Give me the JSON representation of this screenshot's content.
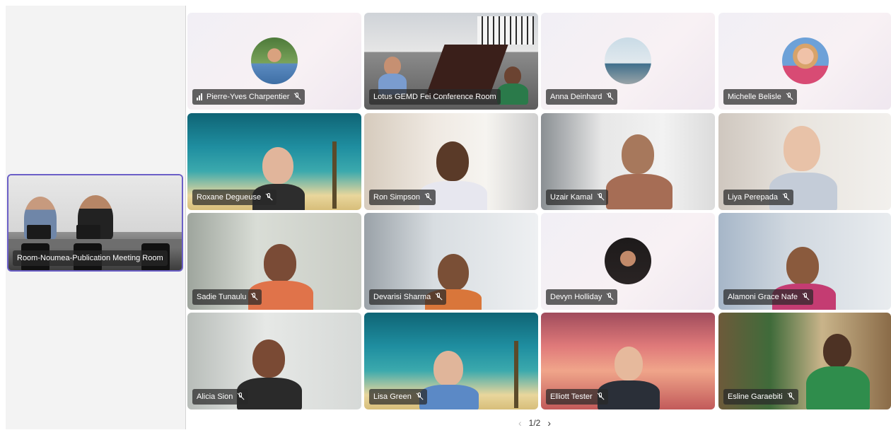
{
  "spotlight": {
    "name": "Room-Noumea-Publication Meeting Room"
  },
  "participants": [
    {
      "name": "Pierre-Yves Charpentier",
      "signal": true
    },
    {
      "name": "Lotus GEMD Fei Conference Room"
    },
    {
      "name": "Anna Deinhard"
    },
    {
      "name": "Michelle Belisle"
    },
    {
      "name": "Roxane Degueuse"
    },
    {
      "name": "Ron Simpson"
    },
    {
      "name": "Uzair Kamal"
    },
    {
      "name": "Liya Perepada"
    },
    {
      "name": "Sadie Tunaulu"
    },
    {
      "name": "Devarisi Sharma"
    },
    {
      "name": "Devyn Holliday"
    },
    {
      "name": "Alamoni Grace Nafe"
    },
    {
      "name": "Alicia Sion"
    },
    {
      "name": "Lisa Green"
    },
    {
      "name": "Elliott Tester"
    },
    {
      "name": "Esline Garaebiti"
    }
  ],
  "pager": {
    "label": "1/2"
  },
  "icons": {
    "muted": "mic-off-icon",
    "signal": "signal-bars-icon",
    "prev": "chevron-left-icon",
    "next": "chevron-right-icon"
  }
}
